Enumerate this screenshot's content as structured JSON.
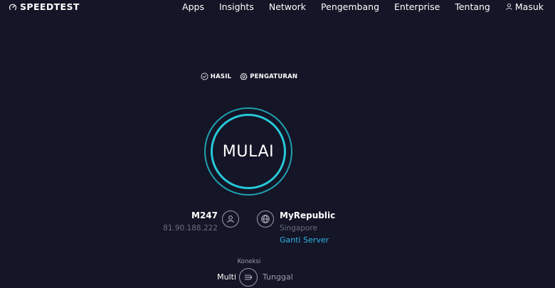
{
  "header": {
    "logo_text": "SPEEDTEST",
    "logo_icon": "speedometer-icon",
    "nav": [
      {
        "label": "Apps"
      },
      {
        "label": "Insights"
      },
      {
        "label": "Network"
      },
      {
        "label": "Pengembang"
      },
      {
        "label": "Enterprise"
      },
      {
        "label": "Tentang"
      }
    ],
    "login_label": "Masuk",
    "login_icon": "user-icon"
  },
  "tabs": [
    {
      "label": "HASIL",
      "icon": "check-circle-icon"
    },
    {
      "label": "PENGATURAN",
      "icon": "gear-icon"
    }
  ],
  "go_button": {
    "label": "MULAI"
  },
  "host": {
    "isp": "M247",
    "ip": "81.90.188.222",
    "icon": "user-icon"
  },
  "server": {
    "name": "MyRepublic",
    "location": "Singapore",
    "change_label": "Ganti Server",
    "icon": "globe-icon"
  },
  "connection": {
    "label": "Koneksi",
    "multi": "Multi",
    "single": "Tunggal",
    "selected": "Multi",
    "icon": "connections-icon"
  },
  "colors": {
    "background": "#141526",
    "accent_ring": "#27c8d8",
    "link": "#2fb4ea",
    "muted": "#6a6c82"
  }
}
